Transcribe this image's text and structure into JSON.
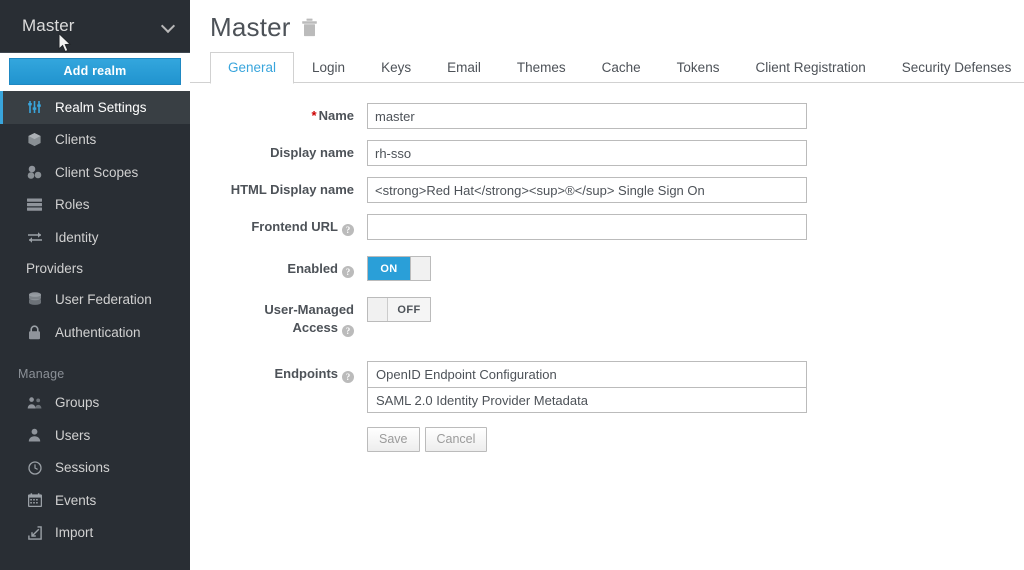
{
  "sidebar": {
    "realm_selector": {
      "name": "Master",
      "icon": "chevron-down-icon"
    },
    "add_realm_label": "Add realm",
    "items": [
      {
        "label": "Realm Settings",
        "icon": "sliders-icon",
        "active": true
      },
      {
        "label": "Clients",
        "icon": "cube-icon",
        "active": false
      },
      {
        "label": "Client Scopes",
        "icon": "molecule-icon",
        "active": false
      },
      {
        "label": "Roles",
        "icon": "list-icon",
        "active": false
      },
      {
        "label": "Identity",
        "icon": "exchange-arrows-icon",
        "active": false
      }
    ],
    "providers_label": "Providers",
    "items2": [
      {
        "label": "User Federation",
        "icon": "database-icon",
        "active": false
      },
      {
        "label": "Authentication",
        "icon": "lock-icon",
        "active": false
      }
    ],
    "manage_section_title": "Manage",
    "manage_items": [
      {
        "label": "Groups",
        "icon": "users-group-icon",
        "active": false
      },
      {
        "label": "Users",
        "icon": "user-icon",
        "active": false
      },
      {
        "label": "Sessions",
        "icon": "clock-icon",
        "active": false
      },
      {
        "label": "Events",
        "icon": "calendar-icon",
        "active": false
      },
      {
        "label": "Import",
        "icon": "import-arrow-icon",
        "active": false
      }
    ]
  },
  "header": {
    "title": "Master",
    "delete_icon": "trash-icon"
  },
  "tabs": [
    {
      "label": "General",
      "active": true
    },
    {
      "label": "Login",
      "active": false
    },
    {
      "label": "Keys",
      "active": false
    },
    {
      "label": "Email",
      "active": false
    },
    {
      "label": "Themes",
      "active": false
    },
    {
      "label": "Cache",
      "active": false
    },
    {
      "label": "Tokens",
      "active": false
    },
    {
      "label": "Client Registration",
      "active": false
    },
    {
      "label": "Security Defenses",
      "active": false
    }
  ],
  "form": {
    "name": {
      "label": "Name",
      "required_marker": "*",
      "value": "master",
      "placeholder": ""
    },
    "display_name": {
      "label": "Display name",
      "value": "rh-sso",
      "placeholder": ""
    },
    "html_display_name": {
      "label": "HTML Display name",
      "value": "<strong>Red Hat</strong><sup>®</sup> Single Sign On",
      "placeholder": ""
    },
    "frontend_url": {
      "label": "Frontend URL",
      "value": "",
      "placeholder": "",
      "help_icon": "help-circle-icon"
    },
    "enabled": {
      "label": "Enabled",
      "state": "ON",
      "help_icon": "help-circle-icon"
    },
    "user_managed_access": {
      "label_line1": "User-Managed",
      "label_line2": "Access",
      "state": "OFF",
      "help_icon": "help-circle-icon"
    },
    "endpoints": {
      "label": "Endpoints",
      "help_icon": "help-circle-icon",
      "links": [
        "OpenID Endpoint Configuration",
        "SAML 2.0 Identity Provider Metadata"
      ]
    },
    "save_label": "Save",
    "cancel_label": "Cancel"
  },
  "colors": {
    "sidebar_bg": "#292e34",
    "sidebar_active_bg": "#393f44",
    "accent_blue": "#39a5dc",
    "button_blue": "#2a9fd8",
    "required_red": "#cc0000",
    "text_dark": "#4d5258",
    "border_grey": "#bbbbbb"
  }
}
